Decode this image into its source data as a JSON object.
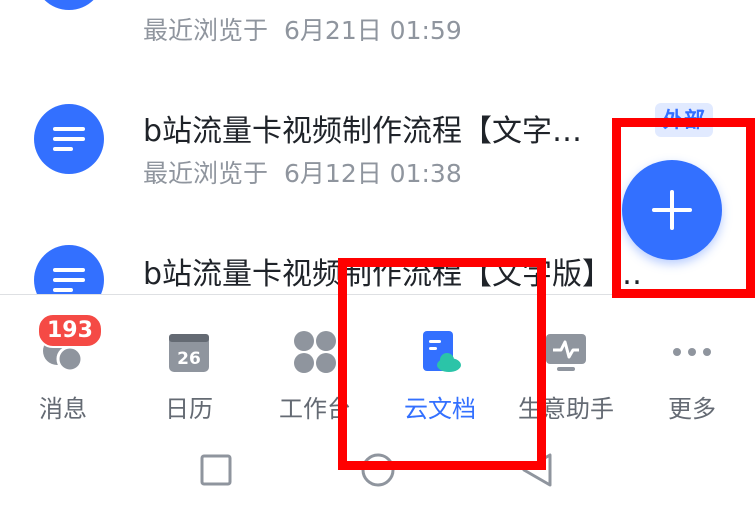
{
  "documents": [
    {
      "title": "",
      "meta_prefix": "最近浏览于",
      "date": "6月21日 01:59",
      "tag": ""
    },
    {
      "title": "b站流量卡视频制作流程【文字…",
      "meta_prefix": "最近浏览于",
      "date": "6月12日 01:38",
      "tag": "外部"
    },
    {
      "title": "b站流量卡视频制作流程【文字版】…",
      "meta_prefix": "",
      "date": "",
      "tag": ""
    }
  ],
  "fab": {
    "icon": "plus-icon"
  },
  "tabs": [
    {
      "label": "消息",
      "icon": "chat-bubbles-icon",
      "badge": "193",
      "active": false
    },
    {
      "label": "日历",
      "icon": "calendar-icon",
      "icon_text": "26",
      "active": false
    },
    {
      "label": "工作台",
      "icon": "apps-grid-icon",
      "active": false
    },
    {
      "label": "云文档",
      "icon": "cloud-doc-icon",
      "active": true
    },
    {
      "label": "生意助手",
      "icon": "monitor-pulse-icon",
      "active": false
    },
    {
      "label": "更多",
      "icon": "more-dots-icon",
      "active": false
    }
  ],
  "system_nav": [
    "square-recents-icon",
    "circle-home-icon",
    "triangle-back-icon"
  ],
  "colors": {
    "accent": "#3370ff",
    "badge": "#f54a45",
    "highlight": "#ff0000",
    "muted_text": "#8f959e"
  }
}
